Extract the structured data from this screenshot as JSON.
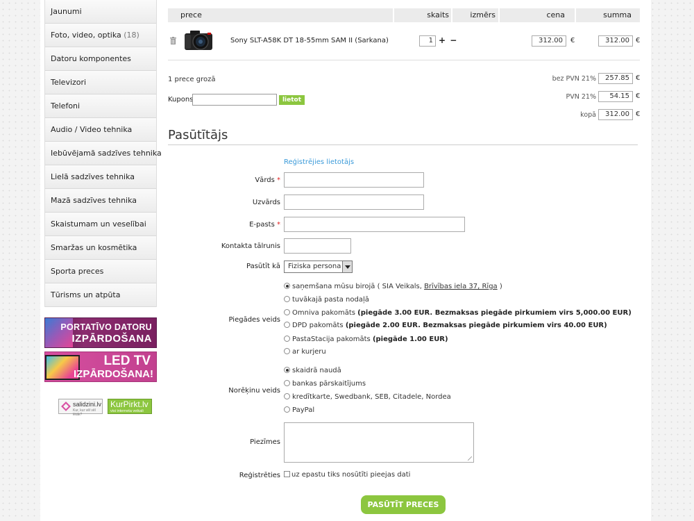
{
  "sidebar": {
    "categories": [
      {
        "label": "Jaunumi",
        "count": ""
      },
      {
        "label": "Foto, video, optika",
        "count": "(18)"
      },
      {
        "label": "Datoru komponentes",
        "count": ""
      },
      {
        "label": "Televizori",
        "count": ""
      },
      {
        "label": "Telefoni",
        "count": ""
      },
      {
        "label": "Audio / Video tehnika",
        "count": ""
      },
      {
        "label": "Iebūvējamā sadzīves tehnika",
        "count": ""
      },
      {
        "label": "Lielā sadzīves tehnika",
        "count": ""
      },
      {
        "label": "Mazā sadzīves tehnika",
        "count": ""
      },
      {
        "label": "Skaistumam un veselībai",
        "count": ""
      },
      {
        "label": "Smaržas un kosmētika",
        "count": ""
      },
      {
        "label": "Sporta preces",
        "count": ""
      },
      {
        "label": "Tūrisms un atpūta",
        "count": ""
      }
    ],
    "banners": [
      {
        "line1": "PORTATĪVO DATORU",
        "line2": "IZPĀRDOŠANA"
      },
      {
        "line1": "LED TV",
        "line2": "IZPĀRDOŠANA!"
      }
    ],
    "logos": [
      {
        "name": "salidzini.lv",
        "tagline": "Kur, kur vēl vēl lētāk?"
      },
      {
        "name": "KurPirkt.lv",
        "tagline": "visi interneta veikali"
      }
    ]
  },
  "cart": {
    "headers": {
      "product": "prece",
      "qty": "skaits",
      "size": "izmērs",
      "price": "cena",
      "total": "summa"
    },
    "item": {
      "name": "Sony SLT-A58K DT 18-55mm SAM II (Sarkana)",
      "qty": "1",
      "qty_controls": "+ −",
      "price": "312.00",
      "total": "312.00",
      "currency": "€"
    },
    "count_text": "1 prece grozā",
    "summary": {
      "net_label": "bez PVN 21%",
      "net_value": "257.85",
      "vat_label": "PVN 21%",
      "vat_value": "54.15",
      "total_label": "kopā",
      "total_value": "312.00"
    },
    "coupon_label": "Kupons",
    "coupon_button": "lietot"
  },
  "order": {
    "title": "Pasūtītājs",
    "register_link": "Reģistrējies lietotājs",
    "fields": {
      "name": "Vārds",
      "surname": "Uzvārds",
      "email": "E-pasts",
      "phone": "Kontakta tālrunis",
      "order_as": "Pasūtīt kā",
      "order_as_value": "Fiziska persona",
      "delivery": "Piegādes veids",
      "payment": "Norēķinu veids",
      "notes": "Piezīmes",
      "register": "Reģistrēties"
    },
    "required_mark": "*",
    "delivery_options": [
      {
        "text": "saņemšana mūsu birojā ( SIA Veikals, ",
        "link": "Brīvības iela 37, Rīga",
        "after": " )",
        "bold": "",
        "selected": true
      },
      {
        "text": "tuvākajā pasta nodaļā",
        "link": "",
        "after": "",
        "bold": "",
        "selected": false
      },
      {
        "text": "Omniva pakomāts ",
        "link": "",
        "after": "",
        "bold": "(piegāde 3.00 EUR. Bezmaksas piegāde pirkumiem virs 5,000.00 EUR)",
        "selected": false
      },
      {
        "text": "DPD pakomāts ",
        "link": "",
        "after": "",
        "bold": "(piegāde 2.00 EUR. Bezmaksas piegāde pirkumiem virs 40.00 EUR)",
        "selected": false
      },
      {
        "text": "PastaStacija pakomāts ",
        "link": "",
        "after": "",
        "bold": "(piegāde 1.00 EUR)",
        "selected": false
      },
      {
        "text": "ar kurjeru",
        "link": "",
        "after": "",
        "bold": "",
        "selected": false
      }
    ],
    "payment_options": [
      {
        "text": "skaidrā naudā",
        "selected": true
      },
      {
        "text": "bankas pārskaitījums",
        "selected": false
      },
      {
        "text": "kredītkarte, Swedbank, SEB, Citadele, Nordea",
        "selected": false
      },
      {
        "text": "PayPal",
        "selected": false
      }
    ],
    "register_checkbox_text": "uz epastu tiks nosūtīti pieejas dati",
    "submit": "PASŪTĪT PRECES"
  },
  "colors": {
    "accent": "#8cc63f",
    "link": "#3a9ad9",
    "required": "#e02020"
  }
}
